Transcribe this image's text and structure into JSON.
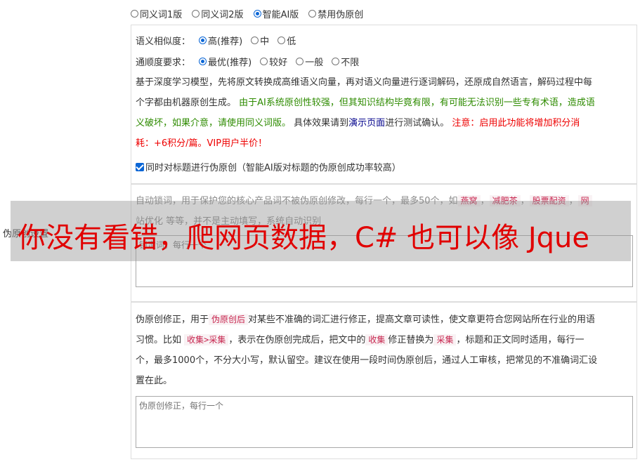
{
  "mode_options": [
    {
      "label": "同义词1版",
      "selected": false
    },
    {
      "label": "同义词2版",
      "selected": false
    },
    {
      "label": "智能AI版",
      "selected": true
    },
    {
      "label": "禁用伪原创",
      "selected": false
    }
  ],
  "similarity": {
    "label": "语义相似度：",
    "options": [
      {
        "label": "高(推荐)",
        "selected": true
      },
      {
        "label": "中",
        "selected": false
      },
      {
        "label": "低",
        "selected": false
      }
    ]
  },
  "fluency": {
    "label": "通顺度要求：",
    "options": [
      {
        "label": "最优(推荐)",
        "selected": true
      },
      {
        "label": "较好",
        "selected": false
      },
      {
        "label": "一般",
        "selected": false
      },
      {
        "label": "不限",
        "selected": false
      }
    ]
  },
  "description": {
    "line1": "基于深度学习模型，先将原文转换成高维语义向量，再对语义向量进行逐词解码，还原成自然语言，解码过程中每",
    "line2_a": "个字都由机器原创生成。",
    "line2_green": "由于AI系统原创性较强，但其知识结构毕竟有限，有可能无法识别一些专有术语，造成语",
    "line3_green": "义破坏，如果介意，请使用同义词版。",
    "line3_a": "具体效果请到",
    "line3_link": "演示页面",
    "line3_b": "进行测试确认。",
    "line3_red": "注意：启用此功能将增加积分消",
    "line4_red": "耗：+6积分/篇。VIP用户半价！"
  },
  "title_checkbox": {
    "label": "同时对标题进行伪原创（智能AI版对标题的伪原创成功率较高）",
    "checked": true
  },
  "side_label": "伪原创设置",
  "lock_words": {
    "line1_a": "自动锁词，用于保护您的核心产品词不被伪原创修改，每行一个，最多50个，如",
    "examples": [
      "燕窝",
      "减肥茶",
      "股票配资"
    ],
    "line1_end": "网",
    "line2": "站优化 等等，并不是主动填写，系统自动识别",
    "placeholder": "锁定词，每行一个"
  },
  "correction": {
    "line1_a": "伪原创修正，用于",
    "code1": "伪原创后",
    "line1_b": "对某些不准确的词汇进行修正，提高文章可读性，使文章更符合您网站所在行业的用语",
    "line2_a": "习惯。比如",
    "code2": "收集>采集",
    "line2_b": "，表示在伪原创完成后，把文中的",
    "code3": "收集",
    "line2_c": "修正替换为",
    "code4": "采集",
    "line2_d": "，标题和正文同时适用，每行一",
    "line3": "个，最多1000个，不分大小写，默认留空。建议在使用一段时间伪原创后，通过人工审核，把常见的不准确词汇设",
    "line4": "置在此。",
    "placeholder": "伪原创修正，每行一个"
  },
  "banner": {
    "text": "你没有看错，爬网页数据，C# 也可以像 Jque"
  },
  "colors": {
    "accent": "#0a66d6",
    "green": "#2e8b00",
    "red": "#e00000",
    "link": "#00008b"
  }
}
